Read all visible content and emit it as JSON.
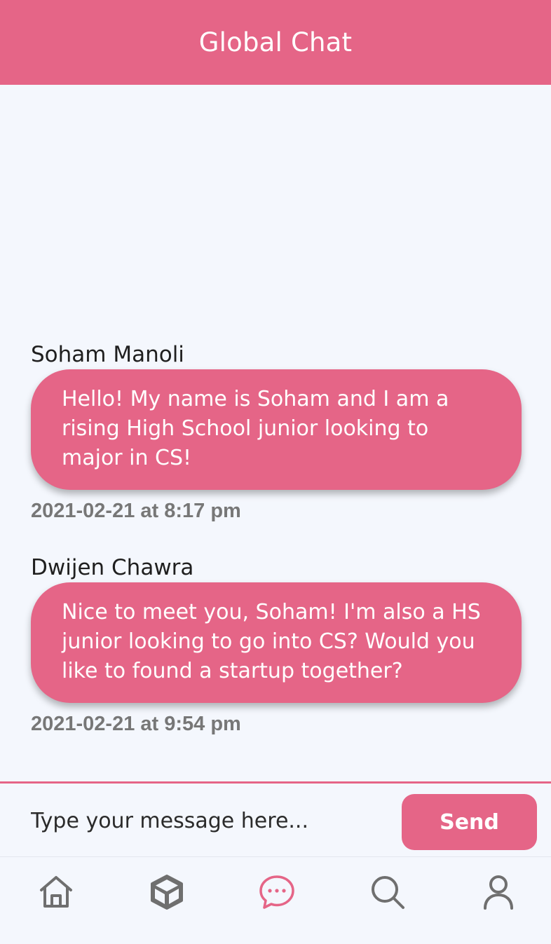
{
  "header": {
    "title": "Global Chat"
  },
  "messages": [
    {
      "sender": "Soham Manoli",
      "text": "Hello! My name is Soham and I am a rising High School junior looking to major in CS!",
      "timestamp": "2021-02-21 at 8:17 pm"
    },
    {
      "sender": "Dwijen Chawra",
      "text": "Nice to meet you, Soham! I'm also a HS junior looking to go into CS? Would you like to found a startup together?",
      "timestamp": "2021-02-21 at 9:54 pm"
    }
  ],
  "composer": {
    "placeholder": "Type your message here...",
    "send_label": "Send"
  },
  "nav": {
    "items": [
      {
        "icon": "home-icon",
        "active": false
      },
      {
        "icon": "cube-icon",
        "active": false
      },
      {
        "icon": "chat-bubble-icon",
        "active": true
      },
      {
        "icon": "search-icon",
        "active": false
      },
      {
        "icon": "profile-icon",
        "active": false
      }
    ]
  },
  "colors": {
    "accent": "#e56587",
    "background": "#f4f7fd",
    "icon_inactive": "#6f6f6f",
    "timestamp": "#777777"
  }
}
